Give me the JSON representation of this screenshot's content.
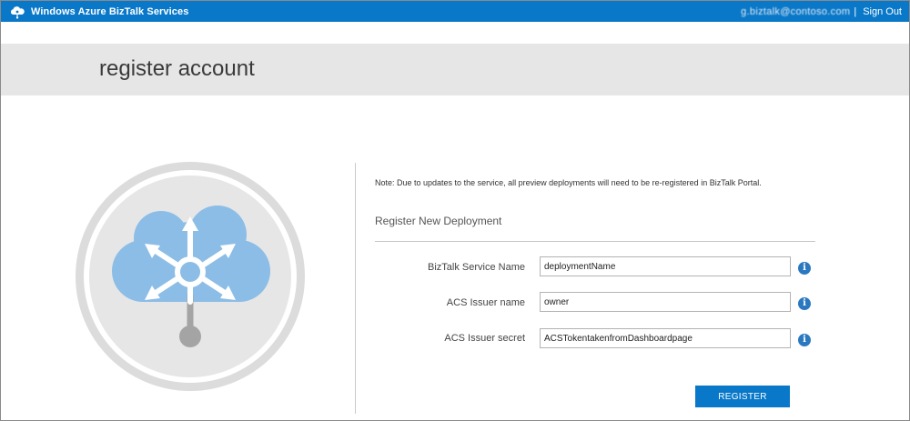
{
  "topbar": {
    "app_title": "Windows Azure BizTalk Services",
    "user_name": "g.biztalk@contoso.com",
    "separator": "|",
    "signout_label": "Sign Out"
  },
  "page": {
    "title": "register account"
  },
  "form": {
    "note": "Note: Due to updates to the service, all preview deployments will need to be re-registered in BizTalk Portal.",
    "section_title": "Register New Deployment",
    "fields": [
      {
        "label": "BizTalk Service Name",
        "value": "deploymentName"
      },
      {
        "label": "ACS Issuer name",
        "value": "owner"
      },
      {
        "label": "ACS Issuer secret",
        "value": "ACSTokentakenfromDashboardpage"
      }
    ],
    "info_glyph": "i",
    "register_label": "REGISTER"
  },
  "colors": {
    "brand_blue": "#0a78c8",
    "header_gray": "#e6e6e6",
    "cloud_blue": "#8bbde6",
    "ring_gray": "#dcdcdc",
    "info_blue": "#2a79c0"
  },
  "icons": {
    "brand": "cloud-network-icon",
    "illustration": "cloud-hub-icon",
    "info": "info-icon"
  }
}
